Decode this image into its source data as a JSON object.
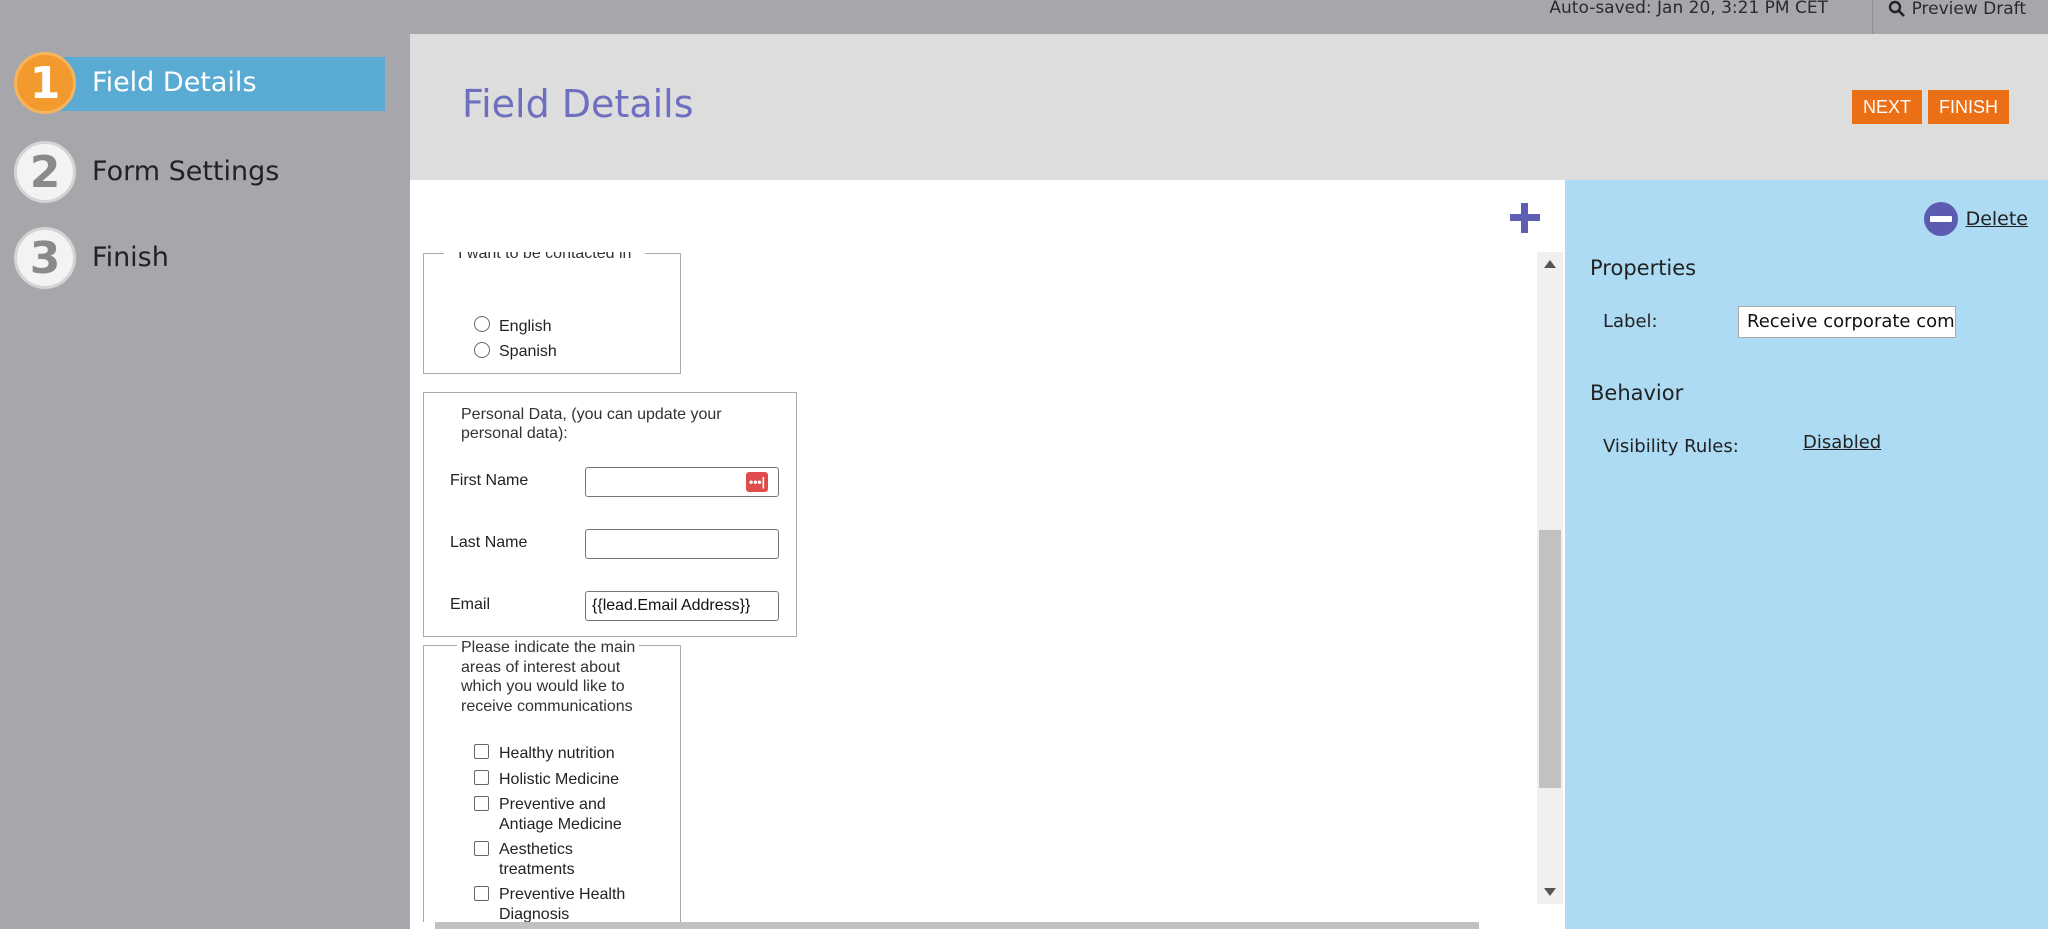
{
  "sidebar": {
    "steps": [
      {
        "number": "1",
        "label": "Field Details"
      },
      {
        "number": "2",
        "label": "Form Settings"
      },
      {
        "number": "3",
        "label": "Finish"
      }
    ]
  },
  "topbar": {
    "autosave": "Auto-saved: Jan 20, 3:21 PM CET",
    "preview": "Preview Draft"
  },
  "header": {
    "title": "Field Details",
    "next": "NEXT",
    "finish": "FINISH"
  },
  "form": {
    "language": {
      "legend": "I want to be contacted in",
      "options": [
        "English",
        "Spanish"
      ]
    },
    "personal": {
      "legend_line1": "Personal Data, (you can update your",
      "legend_line2": "personal data):",
      "first_name": "First Name",
      "last_name": "Last Name",
      "email": "Email",
      "email_value": "{{lead.Email Address}}",
      "pw_icon": "•••|"
    },
    "interests": {
      "legend_lines": [
        "Please indicate the main",
        "areas of interest about",
        "which you would like to",
        "receive communications"
      ],
      "options": [
        [
          "Healthy nutrition"
        ],
        [
          "Holistic Medicine"
        ],
        [
          "Preventive and",
          "Antiage Medicine"
        ],
        [
          "Aesthetics",
          "treatments"
        ],
        [
          "Preventive Health",
          "Diagnosis"
        ]
      ]
    }
  },
  "properties": {
    "delete": "Delete",
    "properties_heading": "Properties",
    "label_label": "Label:",
    "label_value": "Receive corporate comm",
    "behavior_heading": "Behavior",
    "visibility_label": "Visibility Rules:",
    "visibility_value": "Disabled"
  }
}
